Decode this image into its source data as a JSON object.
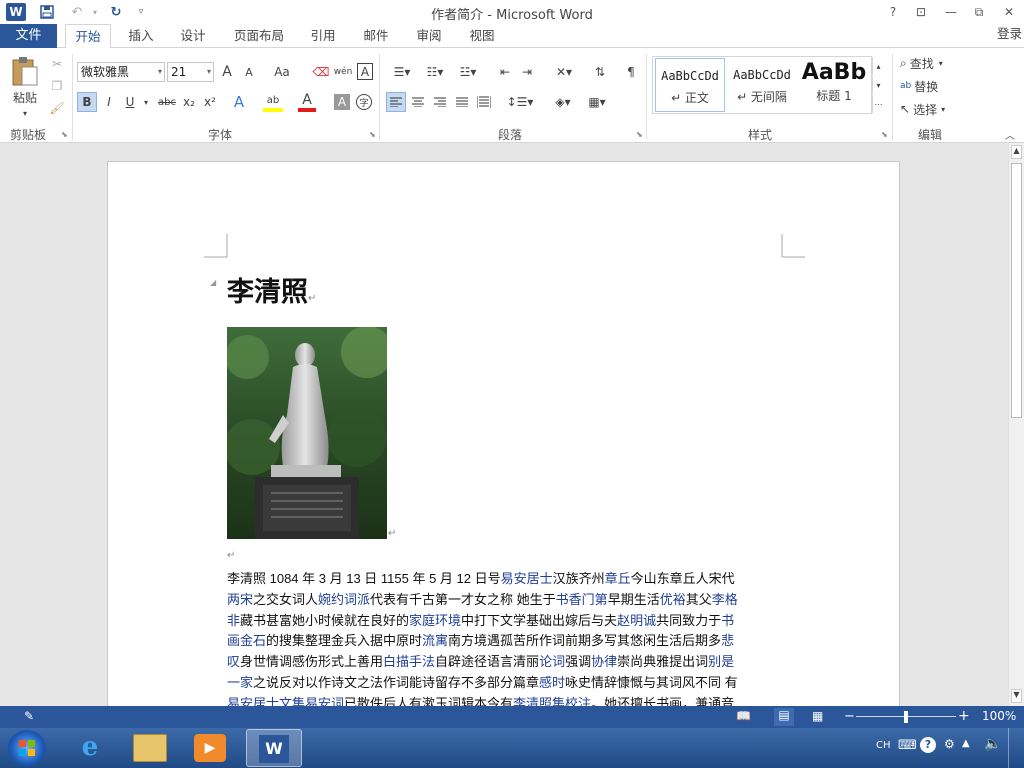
{
  "window": {
    "title": "作者简介 - Microsoft Word",
    "help": "?",
    "ribbon_display": "⊡",
    "minimize": "—",
    "restore": "⧉",
    "close": "✕"
  },
  "quick_access": {
    "app_icon": "W",
    "save": "▣",
    "undo": "↶",
    "redo": "↻",
    "customize": "▿"
  },
  "tabs": {
    "file": "文件",
    "items": [
      "开始",
      "插入",
      "设计",
      "页面布局",
      "引用",
      "邮件",
      "审阅",
      "视图"
    ],
    "active": "开始",
    "login": "登录"
  },
  "ribbon": {
    "clipboard": {
      "label": "剪贴板",
      "paste": "粘贴"
    },
    "font": {
      "label": "字体",
      "font_name": "微软雅黑",
      "font_size": "21",
      "grow": "A",
      "shrink": "A",
      "case": "Aa",
      "pinyin": "wén",
      "border_char": "A",
      "bold": "B",
      "italic": "I",
      "underline": "U",
      "strike": "abc",
      "subscript": "x₂",
      "superscript": "x²",
      "effects": "A",
      "highlight": "ab",
      "font_color": "A",
      "shade_char": "A",
      "enclose": "字"
    },
    "paragraph": {
      "label": "段落"
    },
    "styles": {
      "label": "样式",
      "items": [
        {
          "sample": "AaBbCcDd",
          "name": "↵ 正文"
        },
        {
          "sample": "AaBbCcDd",
          "name": "↵ 无间隔"
        },
        {
          "sample": "AaBb",
          "name": "标题 1"
        }
      ]
    },
    "editing": {
      "label": "编辑",
      "find": "查找",
      "replace": "替换",
      "select": "选择"
    }
  },
  "document": {
    "heading": "李清照",
    "para_mark": "↵",
    "body_lines": [
      [
        {
          "t": "李清照 1084 年 3 月 13 日 1155 年 5 月 12 日号"
        },
        {
          "t": "易安居士",
          "l": true
        },
        {
          "t": "汉族齐州"
        },
        {
          "t": "章丘",
          "l": true
        },
        {
          "t": "今山东章丘人宋代"
        }
      ],
      [
        {
          "t": "两宋",
          "l": true
        },
        {
          "t": "之交女词人"
        },
        {
          "t": "婉约词派",
          "l": true
        },
        {
          "t": "代表有千古第一才女之称  她生于"
        },
        {
          "t": "书香门第",
          "l": true
        },
        {
          "t": "早期生活"
        },
        {
          "t": "优裕",
          "l": true
        },
        {
          "t": "其父"
        },
        {
          "t": "李格",
          "l": true
        }
      ],
      [
        {
          "t": "非",
          "l": true
        },
        {
          "t": "藏书甚富她小时候就在良好的"
        },
        {
          "t": "家庭环境",
          "l": true
        },
        {
          "t": "中打下文学基础出嫁后与夫"
        },
        {
          "t": "赵明诚",
          "l": true
        },
        {
          "t": "共同致力于"
        },
        {
          "t": "书",
          "l": true
        }
      ],
      [
        {
          "t": "画金石",
          "l": true
        },
        {
          "t": "的搜集整理金兵入据中原时"
        },
        {
          "t": "流寓",
          "l": true
        },
        {
          "t": "南方境遇孤苦所作词前期多写其悠闲生活后期多"
        },
        {
          "t": "悲",
          "l": true
        }
      ],
      [
        {
          "t": "叹",
          "l": true
        },
        {
          "t": "身世情调感伤形式上善用"
        },
        {
          "t": "白描手法",
          "l": true
        },
        {
          "t": "自辟途径语言清丽"
        },
        {
          "t": "论词",
          "l": true
        },
        {
          "t": "强调"
        },
        {
          "t": "协律",
          "l": true
        },
        {
          "t": "崇尚典雅提出词"
        },
        {
          "t": "别是",
          "l": true
        }
      ],
      [
        {
          "t": "一家",
          "l": true
        },
        {
          "t": "之说反对以作诗文之法作词能诗留存不多部分篇章"
        },
        {
          "t": "感时",
          "l": true
        },
        {
          "t": "咏史情辞慷慨与其词风不同  有"
        }
      ],
      [
        {
          "t": "易安居士文集",
          "l": true
        },
        {
          "t": "易安词",
          "l": true
        },
        {
          "t": "已散佚后人有漱玉词辑本今有"
        },
        {
          "t": "李清照集校注",
          "l": true
        },
        {
          "t": "。她还擅长书画，兼通音"
        }
      ]
    ]
  },
  "status": {
    "zoom": "100%",
    "zoom_level": 0.5
  },
  "taskbar": {
    "lang": "CH"
  },
  "colors": {
    "accent": "#2b579a",
    "link": "#1f3f95"
  }
}
